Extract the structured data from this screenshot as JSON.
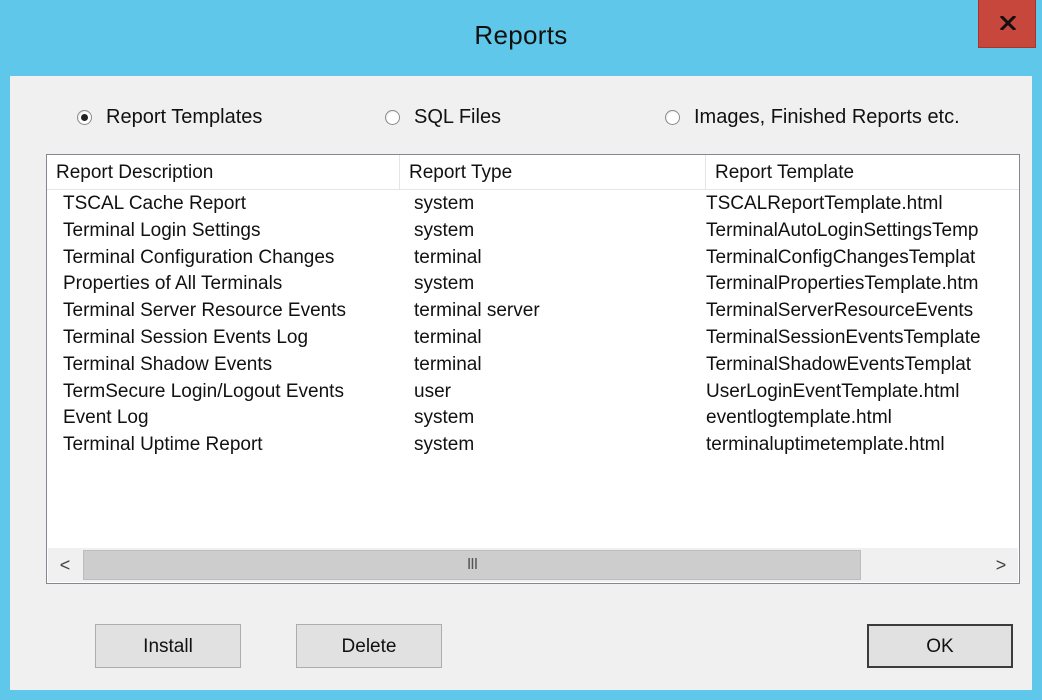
{
  "window": {
    "title": "Reports"
  },
  "radios": [
    {
      "label": "Report Templates",
      "checked": true
    },
    {
      "label": "SQL Files",
      "checked": false
    },
    {
      "label": "Images, Finished Reports etc.",
      "checked": false
    }
  ],
  "list": {
    "columns": [
      "Report Description",
      "Report Type",
      "Report Template"
    ],
    "rows": [
      [
        "TSCAL Cache Report",
        "system",
        "TSCALReportTemplate.html"
      ],
      [
        "Terminal Login Settings",
        "system",
        "TerminalAutoLoginSettingsTemp"
      ],
      [
        "Terminal Configuration Changes",
        "terminal",
        "TerminalConfigChangesTemplat"
      ],
      [
        "Properties of All Terminals",
        "system",
        "TerminalPropertiesTemplate.htm"
      ],
      [
        "Terminal Server Resource Events",
        "terminal server",
        "TerminalServerResourceEvents"
      ],
      [
        "Terminal Session Events Log",
        "terminal",
        "TerminalSessionEventsTemplate"
      ],
      [
        "Terminal Shadow Events",
        "terminal",
        "TerminalShadowEventsTemplat"
      ],
      [
        "TermSecure Login/Logout Events",
        "user",
        "UserLoginEventTemplate.html"
      ],
      [
        "Event Log",
        "system",
        "eventlogtemplate.html"
      ],
      [
        "Terminal Uptime Report",
        "system",
        "terminaluptimetemplate.html"
      ]
    ],
    "scrollbar": {
      "left_glyph": "<",
      "right_glyph": ">",
      "thumb_glyph": "III"
    }
  },
  "buttons": {
    "install": "Install",
    "delete": "Delete",
    "ok": "OK"
  },
  "colors": {
    "titlebar": "#5fc8ea",
    "close": "#c8473d",
    "client": "#f0f0f0"
  }
}
